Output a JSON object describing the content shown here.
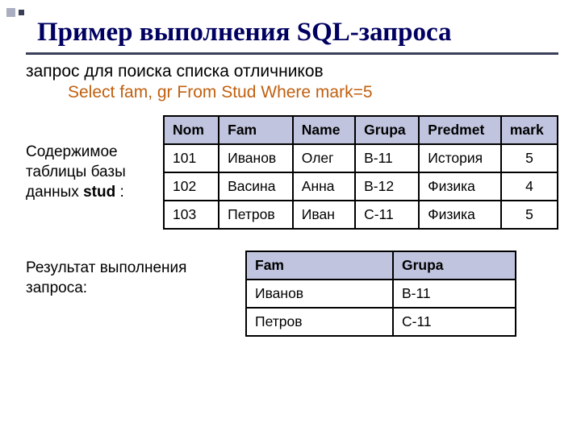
{
  "title": "Пример выполнения SQL-запроса",
  "intro_line": "запрос для поиска списка отличников",
  "sql_line": "Select fam, gr  From Stud  Where mark=5",
  "side_label_line1": "Содержимое",
  "side_label_line2": "таблицы базы",
  "side_label_line3": "данных ",
  "side_label_bold": "stud",
  "side_label_tail": " :",
  "table1": {
    "headers": [
      "Nom",
      "Fam",
      "Name",
      "Grupa",
      "Predmet",
      "mark"
    ],
    "rows": [
      {
        "nom": "101",
        "fam": "Иванов",
        "name": "Олег",
        "grupa": "В-11",
        "predmet": "История",
        "mark": "5"
      },
      {
        "nom": "102",
        "fam": "Васина",
        "name": "Анна",
        "grupa": "В-12",
        "predmet": "Физика",
        "mark": "4"
      },
      {
        "nom": "103",
        "fam": "Петров",
        "name": "Иван",
        "grupa": "С-11",
        "predmet": "Физика",
        "mark": "5"
      }
    ]
  },
  "result_label_line1": "Результат выполнения",
  "result_label_line2": "запроса:",
  "table2": {
    "headers": [
      "Fam",
      "Grupa"
    ],
    "rows": [
      {
        "fam": "Иванов",
        "grupa": "В-11"
      },
      {
        "fam": "Петров",
        "grupa": "С-11"
      }
    ]
  }
}
